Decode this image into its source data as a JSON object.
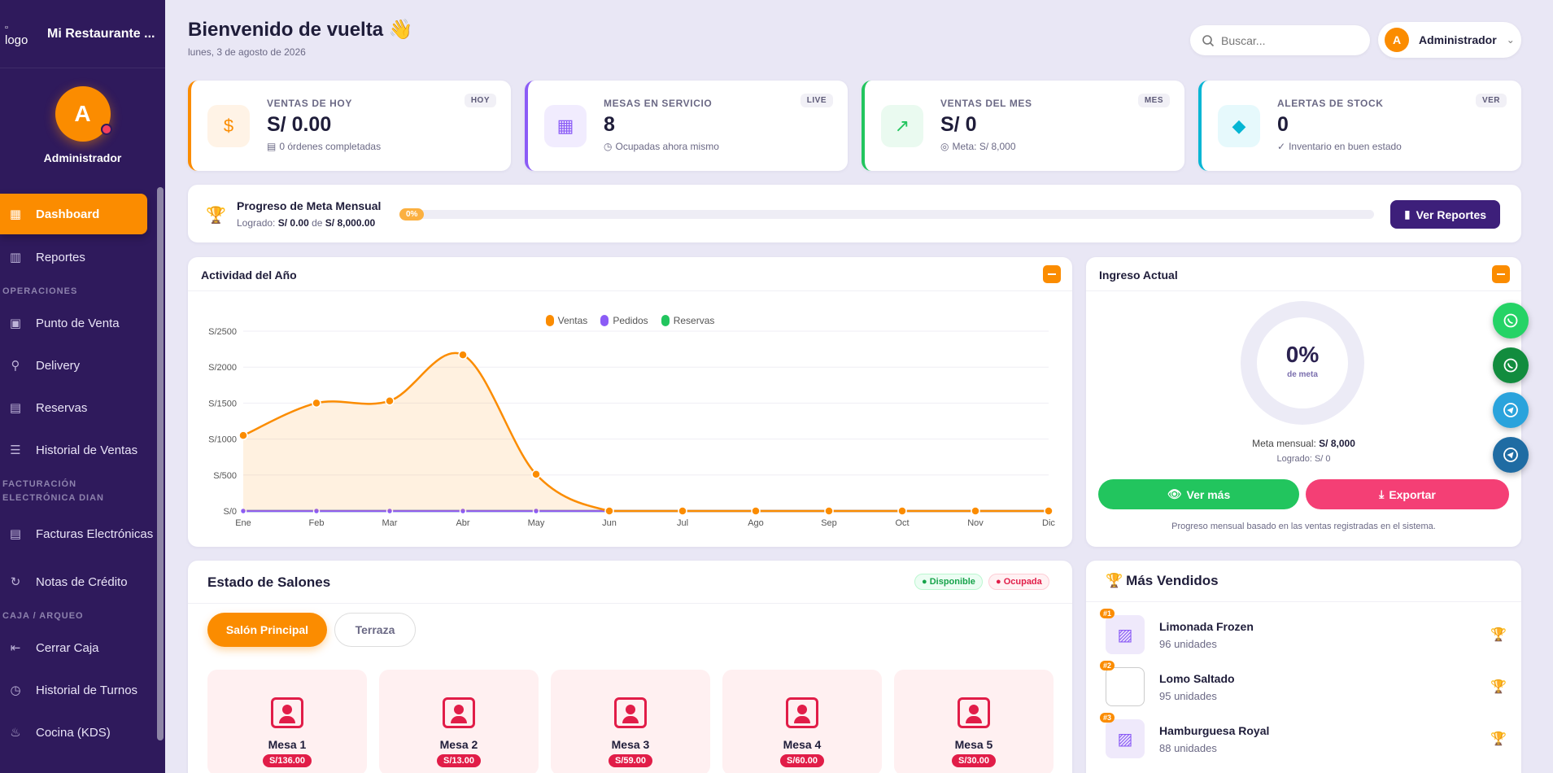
{
  "sidebar": {
    "logo_alt": "logo",
    "brand": "Mi Restaurante ...",
    "user_initial": "A",
    "user_name": "Administrador",
    "nav": [
      {
        "label": "Dashboard",
        "icon": "dashboard-icon",
        "active": true
      },
      {
        "label": "Reportes",
        "icon": "bar-chart-icon"
      },
      {
        "section": "OPERACIONES"
      },
      {
        "label": "Punto de Venta",
        "icon": "shopping-bag-icon"
      },
      {
        "label": "Delivery",
        "icon": "bicycle-icon"
      },
      {
        "label": "Reservas",
        "icon": "calendar-icon"
      },
      {
        "label": "Historial de Ventas",
        "icon": "list-icon"
      },
      {
        "section": "FACTURACIÓN ELECTRÓNICA DIAN"
      },
      {
        "label": "Facturas Electrónicas",
        "icon": "invoice-icon"
      },
      {
        "label": "Notas de Crédito",
        "icon": "refresh-icon"
      },
      {
        "section": "CAJA / ARQUEO"
      },
      {
        "label": "Cerrar Caja",
        "icon": "logout-icon"
      },
      {
        "label": "Historial de Turnos",
        "icon": "clock-icon"
      },
      {
        "label": "Cocina (KDS)",
        "icon": "fire-icon"
      }
    ]
  },
  "header": {
    "title": "Bienvenido de vuelta 👋",
    "date": "lunes, 3 de agosto de 2026",
    "search_placeholder": "Buscar...",
    "user_initial": "A",
    "user_name": "Administrador"
  },
  "stats": [
    {
      "label": "VENTAS DE HOY",
      "value": "S/ 0.00",
      "sub": "0 órdenes completadas",
      "badge": "HOY",
      "color": "#fb8c00",
      "bg": "#fff3e6",
      "icon": "money-icon"
    },
    {
      "label": "MESAS EN SERVICIO",
      "value": "8",
      "sub": "Ocupadas ahora mismo",
      "badge": "LIVE",
      "color": "#8b5cf6",
      "bg": "#f1ecfe",
      "icon": "grid-icon"
    },
    {
      "label": "VENTAS DEL MES",
      "value": "S/ 0",
      "sub": "Meta: S/ 8,000",
      "badge": "MES",
      "color": "#22c55e",
      "bg": "#eafaf0",
      "icon": "trend-up-icon"
    },
    {
      "label": "ALERTAS DE STOCK",
      "value": "0",
      "sub": "Inventario en buen estado",
      "badge": "VER",
      "color": "#06b6d4",
      "bg": "#e6f9fc",
      "icon": "box-icon"
    }
  ],
  "progress": {
    "title": "Progreso de Meta Mensual",
    "achieved_prefix": "Logrado:",
    "achieved": "S/ 0.00",
    "of": "de",
    "goal": "S/ 8,000.00",
    "percent_label": "0%",
    "percent": 0,
    "button": "Ver Reportes"
  },
  "activity": {
    "title": "Actividad del Año"
  },
  "chart_data": {
    "type": "line",
    "categories": [
      "Ene",
      "Feb",
      "Mar",
      "Abr",
      "May",
      "Jun",
      "Jul",
      "Ago",
      "Sep",
      "Oct",
      "Nov",
      "Dic"
    ],
    "series": [
      {
        "name": "Ventas",
        "color": "#fb8c00",
        "values": [
          1050,
          1500,
          1530,
          2170,
          510,
          0,
          0,
          0,
          0,
          0,
          0,
          0
        ]
      },
      {
        "name": "Pedidos",
        "color": "#8b5cf6",
        "values": [
          0,
          0,
          0,
          0,
          0,
          0,
          0,
          0,
          0,
          0,
          0,
          0
        ]
      },
      {
        "name": "Reservas",
        "color": "#22c55e",
        "values": [
          0,
          0,
          0,
          0,
          0,
          0,
          0,
          0,
          0,
          0,
          0,
          0
        ]
      }
    ],
    "y_ticks": [
      "S/0",
      "S/500",
      "S/1000",
      "S/1500",
      "S/2000",
      "S/2500"
    ],
    "ylim": [
      0,
      2500
    ],
    "legend": "top-center",
    "grid": true
  },
  "ingreso": {
    "title": "Ingreso Actual",
    "percent_label": "0%",
    "percent": 0,
    "percent_sub": "de meta",
    "meta_label": "Meta mensual:",
    "meta_value": "S/ 8,000",
    "logrado": "Logrado: S/ 0",
    "btn_more": "Ver más",
    "btn_export": "Exportar",
    "note": "Progreso mensual basado en las ventas registradas en el sistema."
  },
  "salones": {
    "title": "Estado de Salones",
    "tag_free": "● Disponible",
    "tag_busy": "● Ocupada",
    "tabs": [
      "Salón Principal",
      "Terraza"
    ],
    "mesas": [
      {
        "name": "Mesa 1",
        "amount": "S/136.00"
      },
      {
        "name": "Mesa 2",
        "amount": "S/13.00"
      },
      {
        "name": "Mesa 3",
        "amount": "S/59.00"
      },
      {
        "name": "Mesa 4",
        "amount": "S/60.00"
      },
      {
        "name": "Mesa 5",
        "amount": "S/30.00"
      }
    ]
  },
  "top_sellers": {
    "title": "Más Vendidos",
    "items": [
      {
        "rank": "#1",
        "name": "Limonada Frozen",
        "units": "96 unidades"
      },
      {
        "rank": "#2",
        "name": "Lomo Saltado",
        "units": "95 unidades"
      },
      {
        "rank": "#3",
        "name": "Hamburguesa Royal",
        "units": "88 unidades"
      }
    ]
  }
}
